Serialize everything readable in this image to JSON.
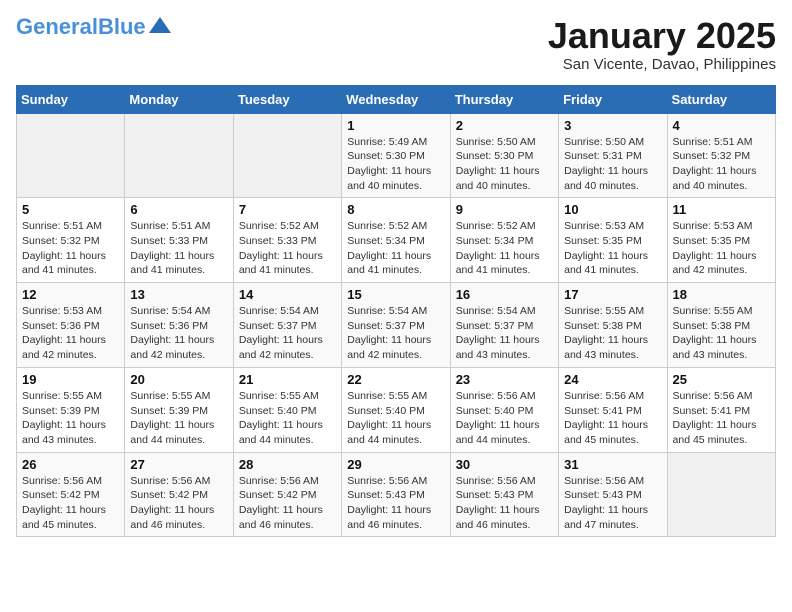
{
  "header": {
    "logo_line1": "General",
    "logo_line2": "Blue",
    "month": "January 2025",
    "location": "San Vicente, Davao, Philippines"
  },
  "weekdays": [
    "Sunday",
    "Monday",
    "Tuesday",
    "Wednesday",
    "Thursday",
    "Friday",
    "Saturday"
  ],
  "weeks": [
    [
      {
        "day": "",
        "info": ""
      },
      {
        "day": "",
        "info": ""
      },
      {
        "day": "",
        "info": ""
      },
      {
        "day": "1",
        "info": "Sunrise: 5:49 AM\nSunset: 5:30 PM\nDaylight: 11 hours\nand 40 minutes."
      },
      {
        "day": "2",
        "info": "Sunrise: 5:50 AM\nSunset: 5:30 PM\nDaylight: 11 hours\nand 40 minutes."
      },
      {
        "day": "3",
        "info": "Sunrise: 5:50 AM\nSunset: 5:31 PM\nDaylight: 11 hours\nand 40 minutes."
      },
      {
        "day": "4",
        "info": "Sunrise: 5:51 AM\nSunset: 5:32 PM\nDaylight: 11 hours\nand 40 minutes."
      }
    ],
    [
      {
        "day": "5",
        "info": "Sunrise: 5:51 AM\nSunset: 5:32 PM\nDaylight: 11 hours\nand 41 minutes."
      },
      {
        "day": "6",
        "info": "Sunrise: 5:51 AM\nSunset: 5:33 PM\nDaylight: 11 hours\nand 41 minutes."
      },
      {
        "day": "7",
        "info": "Sunrise: 5:52 AM\nSunset: 5:33 PM\nDaylight: 11 hours\nand 41 minutes."
      },
      {
        "day": "8",
        "info": "Sunrise: 5:52 AM\nSunset: 5:34 PM\nDaylight: 11 hours\nand 41 minutes."
      },
      {
        "day": "9",
        "info": "Sunrise: 5:52 AM\nSunset: 5:34 PM\nDaylight: 11 hours\nand 41 minutes."
      },
      {
        "day": "10",
        "info": "Sunrise: 5:53 AM\nSunset: 5:35 PM\nDaylight: 11 hours\nand 41 minutes."
      },
      {
        "day": "11",
        "info": "Sunrise: 5:53 AM\nSunset: 5:35 PM\nDaylight: 11 hours\nand 42 minutes."
      }
    ],
    [
      {
        "day": "12",
        "info": "Sunrise: 5:53 AM\nSunset: 5:36 PM\nDaylight: 11 hours\nand 42 minutes."
      },
      {
        "day": "13",
        "info": "Sunrise: 5:54 AM\nSunset: 5:36 PM\nDaylight: 11 hours\nand 42 minutes."
      },
      {
        "day": "14",
        "info": "Sunrise: 5:54 AM\nSunset: 5:37 PM\nDaylight: 11 hours\nand 42 minutes."
      },
      {
        "day": "15",
        "info": "Sunrise: 5:54 AM\nSunset: 5:37 PM\nDaylight: 11 hours\nand 42 minutes."
      },
      {
        "day": "16",
        "info": "Sunrise: 5:54 AM\nSunset: 5:37 PM\nDaylight: 11 hours\nand 43 minutes."
      },
      {
        "day": "17",
        "info": "Sunrise: 5:55 AM\nSunset: 5:38 PM\nDaylight: 11 hours\nand 43 minutes."
      },
      {
        "day": "18",
        "info": "Sunrise: 5:55 AM\nSunset: 5:38 PM\nDaylight: 11 hours\nand 43 minutes."
      }
    ],
    [
      {
        "day": "19",
        "info": "Sunrise: 5:55 AM\nSunset: 5:39 PM\nDaylight: 11 hours\nand 43 minutes."
      },
      {
        "day": "20",
        "info": "Sunrise: 5:55 AM\nSunset: 5:39 PM\nDaylight: 11 hours\nand 44 minutes."
      },
      {
        "day": "21",
        "info": "Sunrise: 5:55 AM\nSunset: 5:40 PM\nDaylight: 11 hours\nand 44 minutes."
      },
      {
        "day": "22",
        "info": "Sunrise: 5:55 AM\nSunset: 5:40 PM\nDaylight: 11 hours\nand 44 minutes."
      },
      {
        "day": "23",
        "info": "Sunrise: 5:56 AM\nSunset: 5:40 PM\nDaylight: 11 hours\nand 44 minutes."
      },
      {
        "day": "24",
        "info": "Sunrise: 5:56 AM\nSunset: 5:41 PM\nDaylight: 11 hours\nand 45 minutes."
      },
      {
        "day": "25",
        "info": "Sunrise: 5:56 AM\nSunset: 5:41 PM\nDaylight: 11 hours\nand 45 minutes."
      }
    ],
    [
      {
        "day": "26",
        "info": "Sunrise: 5:56 AM\nSunset: 5:42 PM\nDaylight: 11 hours\nand 45 minutes."
      },
      {
        "day": "27",
        "info": "Sunrise: 5:56 AM\nSunset: 5:42 PM\nDaylight: 11 hours\nand 46 minutes."
      },
      {
        "day": "28",
        "info": "Sunrise: 5:56 AM\nSunset: 5:42 PM\nDaylight: 11 hours\nand 46 minutes."
      },
      {
        "day": "29",
        "info": "Sunrise: 5:56 AM\nSunset: 5:43 PM\nDaylight: 11 hours\nand 46 minutes."
      },
      {
        "day": "30",
        "info": "Sunrise: 5:56 AM\nSunset: 5:43 PM\nDaylight: 11 hours\nand 46 minutes."
      },
      {
        "day": "31",
        "info": "Sunrise: 5:56 AM\nSunset: 5:43 PM\nDaylight: 11 hours\nand 47 minutes."
      },
      {
        "day": "",
        "info": ""
      }
    ]
  ]
}
